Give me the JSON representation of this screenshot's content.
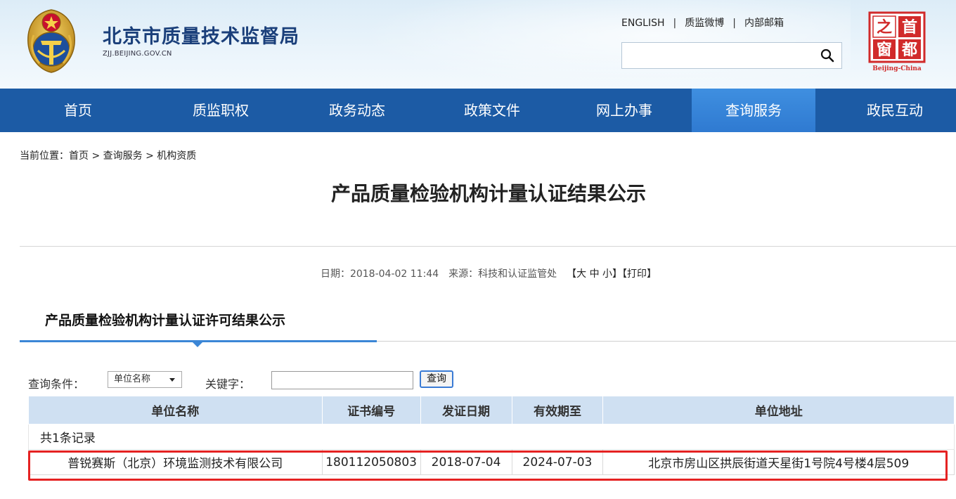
{
  "header": {
    "title": "北京市质量技术监督局",
    "domain": "ZJJ.BEIJING.GOV.CN",
    "links": [
      "ENGLISH",
      "质监微博",
      "内部邮箱"
    ],
    "search_value": "",
    "seal_chars": [
      "之",
      "首",
      "窗",
      "都"
    ],
    "seal_caption": "Beijing-China"
  },
  "nav": {
    "items": [
      "首页",
      "质监职权",
      "政务动态",
      "政策文件",
      "网上办事",
      "查询服务",
      "政民互动"
    ],
    "active": "查询服务"
  },
  "breadcrumb": {
    "prefix": "当前位置：",
    "items": [
      "首页",
      "查询服务",
      "机构资质"
    ],
    "separator": " > "
  },
  "article": {
    "title": "产品质量检验机构计量认证结果公示",
    "date_label": "日期：2018-04-02 11:44",
    "source_label": "来源：科技和认证监管处",
    "font_size_tool": "【大 中 小】",
    "print_tool": "【打印】",
    "subtitle": "产品质量检验机构计量认证许可结果公示"
  },
  "query": {
    "condition_label": "查询条件：",
    "condition_selected": "单位名称",
    "keyword_label": "关键字：",
    "keyword_value": "",
    "button": "查询"
  },
  "table": {
    "headers": [
      "单位名称",
      "证书编号",
      "发证日期",
      "有效期至",
      "单位地址"
    ],
    "count_text": "共1条记录",
    "rows": [
      [
        "普锐赛斯（北京）环境监测技术有限公司",
        "180112050803",
        "2018-07-04",
        "2024-07-03",
        "北京市房山区拱辰街道天星街1号院4号楼4层509"
      ]
    ]
  },
  "colors": {
    "nav_bg": "#1c5ba5",
    "nav_active": "#2f7ad1",
    "table_header_bg": "#cfe0f2",
    "highlight": "#e52222",
    "title_blue": "#1a3f7a"
  }
}
